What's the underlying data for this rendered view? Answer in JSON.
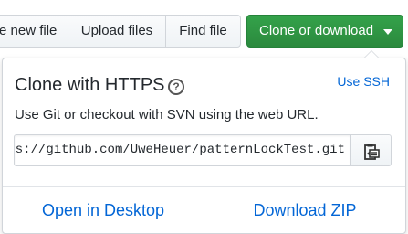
{
  "toolbar": {
    "new_file_label": "e new file",
    "upload_label": "Upload files",
    "find_label": "Find file",
    "clone_label": "Clone or download"
  },
  "clone_panel": {
    "title": "Clone with HTTPS",
    "help_icon": "question-circle-icon",
    "help_glyph": "?",
    "switch_link": "Use SSH",
    "description": "Use Git or checkout with SVN using the web URL.",
    "url_visible": "ps://github.com/UweHeuer/patternLockTest.git",
    "copy_icon": "clipboard-icon",
    "open_desktop": "Open in Desktop",
    "download_zip": "Download ZIP"
  },
  "colors": {
    "clone_button": "#2c973e",
    "link": "#0366d6",
    "border": "#d1d5da"
  }
}
